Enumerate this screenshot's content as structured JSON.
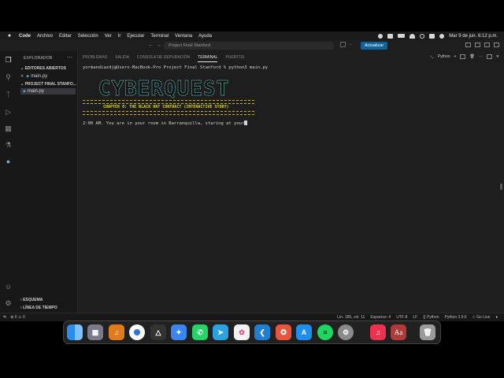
{
  "menubar": {
    "app": "Code",
    "items": [
      "Archivo",
      "Editar",
      "Selección",
      "Ver",
      "Ir",
      "Ejecutar",
      "Terminal",
      "Ventana",
      "Ayuda"
    ],
    "datetime": "Mar 9 de jun.  6:12 p.m."
  },
  "titlebar": {
    "search_placeholder": "Project Final Stanford",
    "update_label": "Actualizar"
  },
  "sidebar": {
    "title": "EXPLORADOR",
    "open_editors": "EDITORES ABIERTOS",
    "open_file": "main.py",
    "project": "PROJECT FINAL STANFO...",
    "project_file": "main.py",
    "outline": "ESQUEMA",
    "timeline": "LÍNEA DE TIEMPO"
  },
  "panel": {
    "tabs": [
      "PROBLEMAS",
      "SALIDA",
      "CONSOLA DE DEPURACIÓN",
      "TERMINAL",
      "PUERTOS"
    ],
    "shell": "Python"
  },
  "terminal": {
    "prompt": "yormandiazdj@Users-MacBook-Pro Project Final Stanford % python3 main.py",
    "banner": "CYBERQUEST",
    "chapter": "CHAPTER 0: THE BLACK HAT CONTRACT (INTERACTIVE STORY)",
    "story": "2:00 AM. You are in your room in Barranquilla, staring at your"
  },
  "statusbar": {
    "errors": "0",
    "warnings": "0",
    "position": "Lín. 185, col. 11",
    "spaces": "Espacios: 4",
    "encoding": "UTF-8",
    "eol": "LF",
    "language": "Python",
    "interpreter": "Python 3.9.6",
    "golive": "Go Live"
  },
  "dock": {
    "apps": [
      "finder-icon",
      "launchpad-icon",
      "fl-studio-icon",
      "chrome-icon",
      "unity-icon",
      "safari-icon",
      "whatsapp-icon",
      "telegram-icon",
      "photos-icon",
      "vscode-icon",
      "app-icon",
      "app-store-icon",
      "spotify-icon",
      "system-settings-icon",
      "music-icon",
      "dictionary-icon",
      "trash-icon"
    ],
    "dictionary_label": "Aa"
  }
}
